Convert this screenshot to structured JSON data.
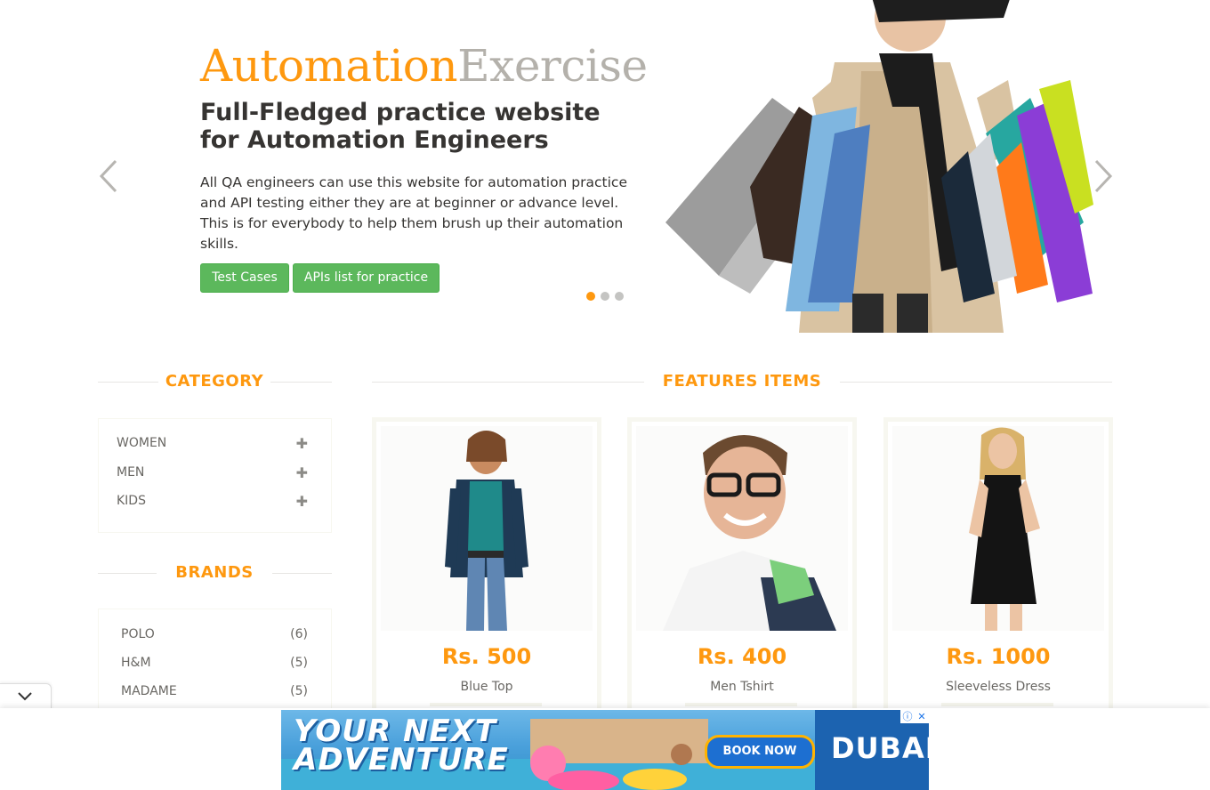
{
  "slider": {
    "brand_part1": "Automation",
    "brand_part2": "Exercise",
    "heading": "Full-Fledged practice website for Automation Engineers",
    "description": "All QA engineers can use this website for automation practice and API testing either they are at beginner or advance level. This is for everybody to help them brush up their automation skills.",
    "btn_test_cases": "Test Cases",
    "btn_apis": "APIs list for practice"
  },
  "category": {
    "title": "CATEGORY",
    "items": [
      {
        "label": "WOMEN",
        "icon": "plus-icon"
      },
      {
        "label": "MEN",
        "icon": "plus-icon"
      },
      {
        "label": "KIDS",
        "icon": "plus-icon"
      }
    ]
  },
  "brands": {
    "title": "BRANDS",
    "items": [
      {
        "name": "POLO",
        "count": "(6)"
      },
      {
        "name": "H&M",
        "count": "(5)"
      },
      {
        "name": "MADAME",
        "count": "(5)"
      }
    ]
  },
  "features": {
    "title": "FEATURES ITEMS",
    "products": [
      {
        "price": "Rs. 500",
        "name": "Blue Top"
      },
      {
        "price": "Rs. 400",
        "name": "Men Tshirt"
      },
      {
        "price": "Rs. 1000",
        "name": "Sleeveless Dress"
      }
    ]
  },
  "ad": {
    "headline_line1": "YOUR NEXT",
    "headline_line2": "ADVENTURE",
    "cta": "BOOK NOW",
    "logo": "DUBAI"
  },
  "colors": {
    "accent": "#FE980F",
    "green_button": "#5cb85c",
    "text": "#696763"
  }
}
